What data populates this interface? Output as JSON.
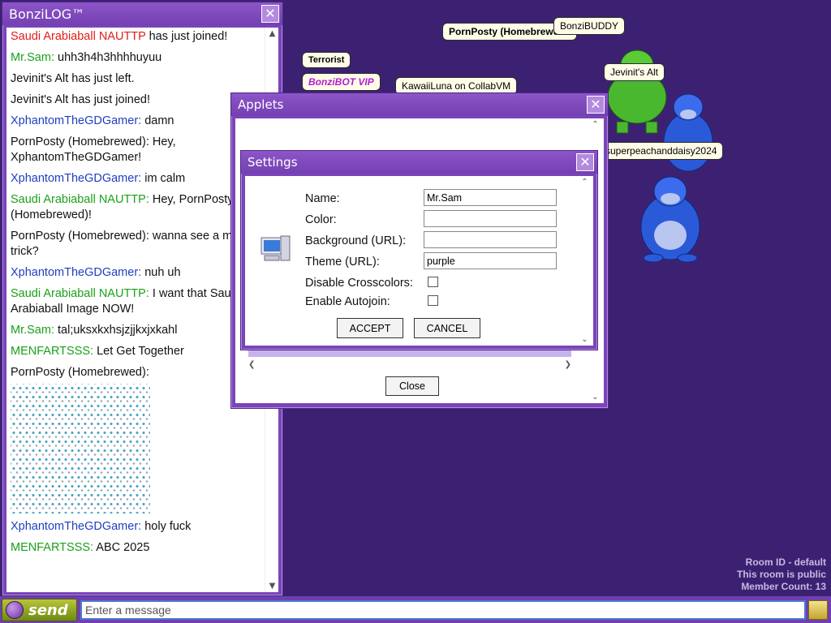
{
  "log": {
    "title": "BonziLOG™",
    "close": "✕",
    "messages": [
      {
        "sender": "Saudi Arabiaball NAUTTP",
        "text": " has just joined!",
        "color": "#e11b1b"
      },
      {
        "sender": "Mr.Sam:",
        "text": " uhh3h4h3hhhhuyuu",
        "color": "#1aa11a"
      },
      {
        "sender": "",
        "text": "Jevinit's Alt has just left.",
        "color": "#111111"
      },
      {
        "sender": "",
        "text": "Jevinit's Alt has just joined!",
        "color": "#111111"
      },
      {
        "sender": "XphantomTheGDGamer:",
        "text": " damn",
        "color": "#1f3fbf"
      },
      {
        "sender": "PornPosty (Homebrewed):",
        "text": " Hey, XphantomTheGDGamer!",
        "color": "#111111"
      },
      {
        "sender": "XphantomTheGDGamer:",
        "text": " im calm",
        "color": "#1f3fbf"
      },
      {
        "sender": "Saudi Arabiaball NAUTTP:",
        "text": " Hey, PornPosty (Homebrewed)!",
        "color": "#1aa11a"
      },
      {
        "sender": "PornPosty (Homebrewed):",
        "text": " wanna see a magic trick?",
        "color": "#111111"
      },
      {
        "sender": "XphantomTheGDGamer:",
        "text": " nuh uh",
        "color": "#1f3fbf"
      },
      {
        "sender": "Saudi Arabiaball NAUTTP:",
        "text": " I want that Saudi Arabiaball Image NOW!",
        "color": "#1aa11a"
      },
      {
        "sender": "Mr.Sam:",
        "text": " tal;uksxkxhsjzjjkxjxkahl",
        "color": "#1aa11a"
      },
      {
        "sender": "MENFARTSSS:",
        "text": " Let Get Together",
        "color": "#1aa11a"
      },
      {
        "sender": "PornPosty (Homebrewed):",
        "text": "",
        "color": "#111111",
        "image": true
      },
      {
        "sender": "XphantomTheGDGamer:",
        "text": " holy fuck",
        "color": "#1f3fbf"
      },
      {
        "sender": "MENFARTSSS:",
        "text": " ABC 2025",
        "color": "#1aa11a"
      }
    ]
  },
  "bubbles": [
    {
      "label": "PornPosty (Homebrewed",
      "bold": true,
      "italic": "(Homebrewed"
    },
    {
      "label": "BonziBUDDY"
    },
    {
      "label": "Terrorist",
      "bold": true
    },
    {
      "label": "BonziBOT VIP",
      "bold": true,
      "italic": true,
      "color": "#b11bd6"
    },
    {
      "label": "KawaiiLuna on CollabVM"
    },
    {
      "label": "Jevinit's Alt"
    },
    {
      "label": "superpeachanddaisy2024"
    }
  ],
  "applets": {
    "title": "Applets",
    "close": "✕",
    "close_button": "Close"
  },
  "settings": {
    "title": "Settings",
    "close": "✕",
    "name_label": "Name:",
    "name_value": "Mr.Sam",
    "color_label": "Color:",
    "color_value": "",
    "background_label": "Background (URL):",
    "background_value": "",
    "theme_label": "Theme (URL):",
    "theme_value": "purple",
    "crosscolors_label": "Disable Crosscolors:",
    "crosscolors_checked": false,
    "autojoin_label": "Enable Autojoin:",
    "autojoin_checked": false,
    "accept_label": "ACCEPT",
    "cancel_label": "CANCEL",
    "icon": "computer-icon"
  },
  "room": {
    "room_id": "Room ID - default",
    "public": "This room is public",
    "member_count": "Member Count: 13"
  },
  "bottombar": {
    "send_label": "send",
    "input_placeholder": "Enter a message"
  },
  "colors": {
    "background": "#3c2173",
    "window": "#7a44b9",
    "accent_blue": "#1f3fbf",
    "accent_green": "#1aa11a",
    "accent_red": "#e11b1b"
  }
}
